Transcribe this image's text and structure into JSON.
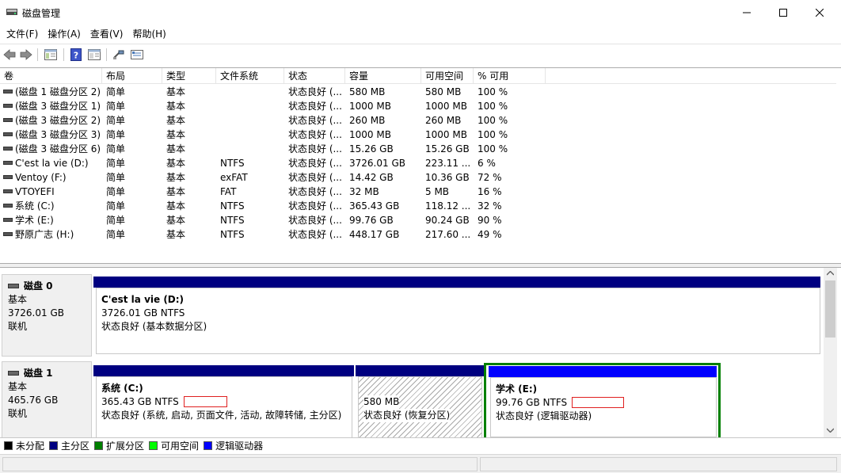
{
  "window": {
    "title": "磁盘管理"
  },
  "menu": [
    "文件(F)",
    "操作(A)",
    "查看(V)",
    "帮助(H)"
  ],
  "toolbar": [
    "back-icon",
    "forward-icon",
    "console-tree-icon",
    "help-icon",
    "properties-icon",
    "connect-icon",
    "settings-icon"
  ],
  "table": {
    "columns": [
      "卷",
      "布局",
      "类型",
      "文件系统",
      "状态",
      "容量",
      "可用空间",
      "% 可用"
    ],
    "rows": [
      [
        "(磁盘 1 磁盘分区 2)",
        "简单",
        "基本",
        "",
        "状态良好 (...",
        "580 MB",
        "580 MB",
        "100 %"
      ],
      [
        "(磁盘 3 磁盘分区 1)",
        "简单",
        "基本",
        "",
        "状态良好 (...",
        "1000 MB",
        "1000 MB",
        "100 %"
      ],
      [
        "(磁盘 3 磁盘分区 2)",
        "简单",
        "基本",
        "",
        "状态良好 (...",
        "260 MB",
        "260 MB",
        "100 %"
      ],
      [
        "(磁盘 3 磁盘分区 3)",
        "简单",
        "基本",
        "",
        "状态良好 (...",
        "1000 MB",
        "1000 MB",
        "100 %"
      ],
      [
        "(磁盘 3 磁盘分区 6)",
        "简单",
        "基本",
        "",
        "状态良好 (...",
        "15.26 GB",
        "15.26 GB",
        "100 %"
      ],
      [
        "C'est la vie (D:)",
        "简单",
        "基本",
        "NTFS",
        "状态良好 (...",
        "3726.01 GB",
        "223.11 ...",
        "6 %"
      ],
      [
        "Ventoy (F:)",
        "简单",
        "基本",
        "exFAT",
        "状态良好 (...",
        "14.42 GB",
        "10.36 GB",
        "72 %"
      ],
      [
        "VTOYEFI",
        "简单",
        "基本",
        "FAT",
        "状态良好 (...",
        "32 MB",
        "5 MB",
        "16 %"
      ],
      [
        "系统 (C:)",
        "简单",
        "基本",
        "NTFS",
        "状态良好 (...",
        "365.43 GB",
        "118.12 ...",
        "32 %"
      ],
      [
        "学术 (E:)",
        "简单",
        "基本",
        "NTFS",
        "状态良好 (...",
        "99.76 GB",
        "90.24 GB",
        "90 %"
      ],
      [
        "野原广志 (H:)",
        "简单",
        "基本",
        "NTFS",
        "状态良好 (...",
        "448.17 GB",
        "217.60 ...",
        "49 %"
      ]
    ]
  },
  "disks": [
    {
      "name": "磁盘 0",
      "type": "基本",
      "size": "3726.01 GB",
      "status": "联机",
      "partitions": [
        {
          "title": "C'est la vie  (D:)",
          "size": "3726.01 GB NTFS",
          "status": "状态良好 (基本数据分区)",
          "bar_color": "#000080"
        }
      ]
    },
    {
      "name": "磁盘 1",
      "type": "基本",
      "size": "465.76 GB",
      "status": "联机",
      "partitions": [
        {
          "title": "系统  (C:)",
          "size": "365.43 GB NTFS",
          "status": "状态良好 (系统, 启动, 页面文件, 活动, 故障转储, 主分区)",
          "bar_color": "#000080"
        },
        {
          "title": "",
          "size": "580 MB",
          "status": "状态良好 (恢复分区)",
          "bar_color": "#000080"
        },
        {
          "title": "学术  (E:)",
          "size": "99.76 GB NTFS",
          "status": "状态良好 (逻辑驱动器)",
          "bar_color": "#0000ff"
        }
      ]
    }
  ],
  "legend": [
    {
      "label": "未分配",
      "color": "#000000"
    },
    {
      "label": "主分区",
      "color": "#000080"
    },
    {
      "label": "扩展分区",
      "color": "#008000"
    },
    {
      "label": "可用空间",
      "color": "#00ff00"
    },
    {
      "label": "逻辑驱动器",
      "color": "#0000ff"
    }
  ]
}
